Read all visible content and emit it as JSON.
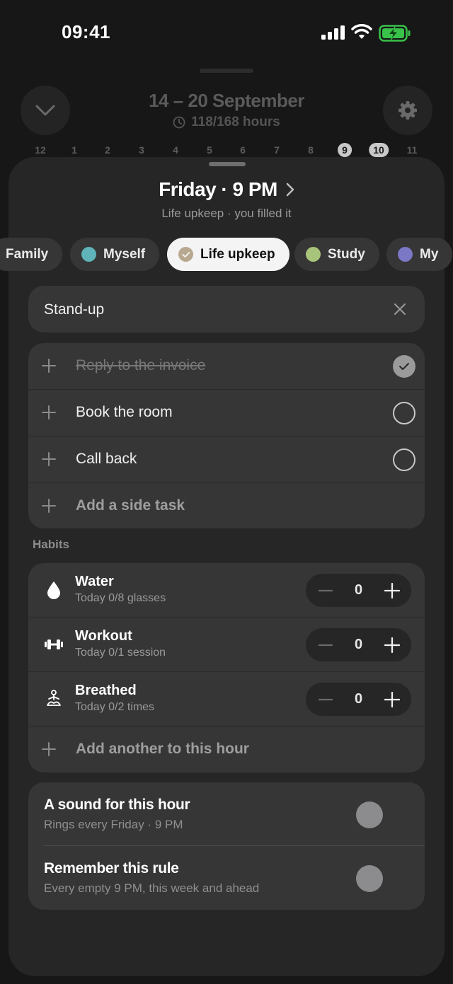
{
  "status_bar": {
    "time": "09:41"
  },
  "week": {
    "title": "14 – 20 September",
    "hours": "118/168 hours"
  },
  "hours_strip": [
    {
      "label": "12",
      "selected": false
    },
    {
      "label": "1",
      "selected": false
    },
    {
      "label": "2",
      "selected": false
    },
    {
      "label": "3",
      "selected": false
    },
    {
      "label": "4",
      "selected": false
    },
    {
      "label": "5",
      "selected": false
    },
    {
      "label": "6",
      "selected": false
    },
    {
      "label": "7",
      "selected": false
    },
    {
      "label": "8",
      "selected": false
    },
    {
      "label": "9",
      "selected": true
    },
    {
      "label": "10",
      "selected": true
    },
    {
      "label": "11",
      "selected": false
    }
  ],
  "sheet": {
    "title": "Friday · 9 PM",
    "subtitle": "Life upkeep · you filled it"
  },
  "categories": [
    {
      "label": "Family",
      "color": "",
      "icon": ""
    },
    {
      "label": "Myself",
      "color": "#5fb3b9",
      "icon": "dot"
    },
    {
      "label": "Life upkeep",
      "color": "#b8a890",
      "icon": "check-icon",
      "selected": true
    },
    {
      "label": "Study",
      "color": "#a8c47a",
      "icon": "dot"
    },
    {
      "label": "My",
      "color": "#7b78c6",
      "icon": "dot"
    }
  ],
  "title_field": {
    "value": "Stand-up"
  },
  "tasks": [
    {
      "label": "Reply to the invoice",
      "done": true
    },
    {
      "label": "Book the room",
      "done": false
    },
    {
      "label": "Call back",
      "done": false
    }
  ],
  "add_task_label": "Add a side task",
  "habits_heading": "Habits",
  "habits": [
    {
      "name": "Water",
      "sub": "Today 0/8 glasses",
      "count": "0",
      "icon": "water-drop-icon"
    },
    {
      "name": "Workout",
      "sub": "Today 0/1 session",
      "count": "0",
      "icon": "dumbbell-icon"
    },
    {
      "name": "Breathed",
      "sub": "Today 0/2 times",
      "count": "0",
      "icon": "meditation-icon"
    }
  ],
  "add_habit_label": "Add another to this hour",
  "rules": [
    {
      "title": "A sound for this hour",
      "sub": "Rings every Friday · 9 PM",
      "on": false
    },
    {
      "title": "Remember this rule",
      "sub": "Every empty 9 PM, this week and ahead",
      "on": false
    }
  ]
}
